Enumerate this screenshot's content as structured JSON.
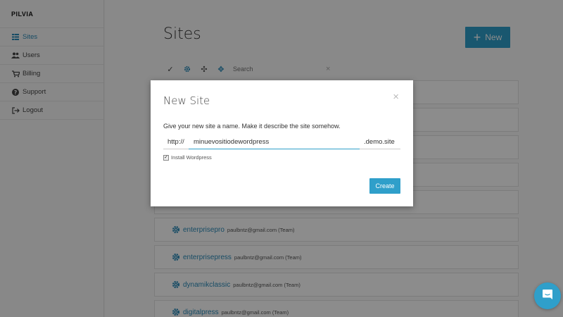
{
  "brand": "PILVIA",
  "sidebar": {
    "items": [
      {
        "label": "Sites",
        "icon": "grid-icon"
      },
      {
        "label": "Users",
        "icon": "users-icon"
      },
      {
        "label": "Billing",
        "icon": "cart-icon"
      },
      {
        "label": "Support",
        "icon": "question-icon"
      },
      {
        "label": "Logout",
        "icon": "logout-icon"
      }
    ]
  },
  "main": {
    "title": "Sites",
    "new_button": "New",
    "search_placeholder": "Search",
    "sites": [
      {
        "name": "",
        "owner": ""
      },
      {
        "name": "",
        "owner": ""
      },
      {
        "name": "",
        "owner": ""
      },
      {
        "name": "",
        "owner": ""
      },
      {
        "name": "",
        "owner": ""
      },
      {
        "name": "enterprisepro",
        "owner": "paulbntz@gmail.com (Team)"
      },
      {
        "name": "enterprisepress",
        "owner": "paulbntz@gmail.com (Team)"
      },
      {
        "name": "dynamikclassic",
        "owner": "paulbntz@gmail.com (Team)"
      },
      {
        "name": "digitalpress",
        "owner": "paulbntz@gmail.com (Team)"
      }
    ]
  },
  "modal": {
    "title": "New Site",
    "close": "×",
    "description": "Give your new site a name. Make it describe the site somehow.",
    "prefix": "http://",
    "site_name_value": "minuevositiodewordpress",
    "suffix": ".demo.site",
    "install_checkbox_label": "Install Wordpress",
    "install_checked": true,
    "create_button": "Create"
  },
  "colors": {
    "accent": "#2f9fca",
    "link": "#2a8ab8"
  }
}
